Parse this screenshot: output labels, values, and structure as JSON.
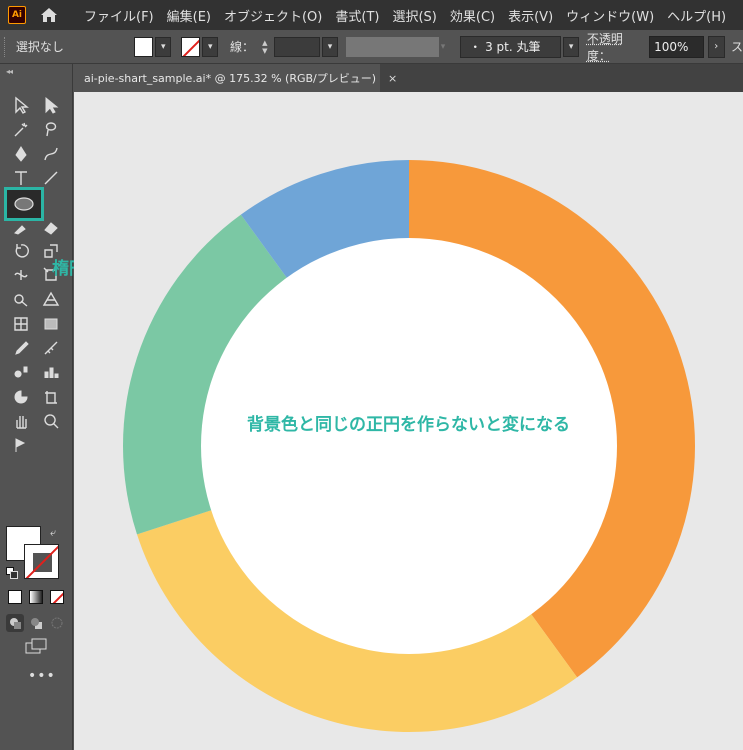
{
  "menubar": {
    "logo_text": "Ai",
    "items": [
      "ファイル(F)",
      "編集(E)",
      "オブジェクト(O)",
      "書式(T)",
      "選択(S)",
      "効果(C)",
      "表示(V)",
      "ウィンドウ(W)",
      "ヘルプ(H)"
    ]
  },
  "control": {
    "selection": "選択なし",
    "stroke_label": "線：",
    "brush": "・ 3 pt. 丸筆",
    "opacity_label": "不透明度：",
    "opacity_value": "100%",
    "style_label": "ス"
  },
  "toolbar": {
    "callout": "楕円形ツール"
  },
  "tab": {
    "title": "ai-pie-shart_sample.ai* @ 175.32 % (RGB/プレビュー)",
    "close": "×"
  },
  "canvas": {
    "center_text": "背景色と同じの正円を作らないと変になる",
    "background": "#e8e8e8"
  },
  "chart_data": {
    "type": "pie",
    "style": "donut",
    "slices": [
      {
        "color": "#f7993b",
        "fraction": 0.4
      },
      {
        "color": "#fbcd63",
        "fraction": 0.3
      },
      {
        "color": "#7bc8a4",
        "fraction": 0.2
      },
      {
        "color": "#6fa5d7",
        "fraction": 0.1
      }
    ],
    "start_angle_deg": 0,
    "direction": "clockwise"
  },
  "colors": {
    "accent": "#2fb7a6",
    "panel": "#535353",
    "menubar": "#323232"
  }
}
